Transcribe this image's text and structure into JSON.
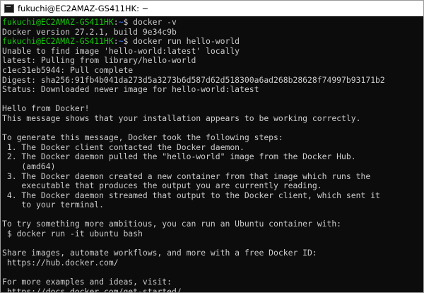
{
  "window": {
    "title": "fukuchi@EC2AMAZ-GS411HK: ~",
    "icon": "terminal-icon"
  },
  "colors": {
    "background": "#0c0c0c",
    "text": "#cccccc",
    "prompt_user": "#16c60c",
    "prompt_path": "#3b78ff"
  },
  "terminal": {
    "lines": [
      {
        "type": "prompt",
        "user": "fukuchi@EC2AMAZ-GS411HK",
        "sep": ":",
        "path": "~",
        "symbol": "$ ",
        "command": "docker -v"
      },
      {
        "type": "text",
        "text": "Docker version 27.2.1, build 9e34c9b"
      },
      {
        "type": "prompt",
        "user": "fukuchi@EC2AMAZ-GS411HK",
        "sep": ":",
        "path": "~",
        "symbol": "$ ",
        "command": "docker run hello-world"
      },
      {
        "type": "text",
        "text": "Unable to find image 'hello-world:latest' locally"
      },
      {
        "type": "text",
        "text": "latest: Pulling from library/hello-world"
      },
      {
        "type": "text",
        "text": "c1ec31eb5944: Pull complete"
      },
      {
        "type": "text",
        "text": "Digest: sha256:91fb4b041da273d5a3273b6d587d62d518300a6ad268b28628f74997b93171b2"
      },
      {
        "type": "text",
        "text": "Status: Downloaded newer image for hello-world:latest"
      },
      {
        "type": "text",
        "text": ""
      },
      {
        "type": "text",
        "text": "Hello from Docker!"
      },
      {
        "type": "text",
        "text": "This message shows that your installation appears to be working correctly."
      },
      {
        "type": "text",
        "text": ""
      },
      {
        "type": "text",
        "text": "To generate this message, Docker took the following steps:"
      },
      {
        "type": "text",
        "text": " 1. The Docker client contacted the Docker daemon."
      },
      {
        "type": "text",
        "text": " 2. The Docker daemon pulled the \"hello-world\" image from the Docker Hub."
      },
      {
        "type": "text",
        "text": "    (amd64)"
      },
      {
        "type": "text",
        "text": " 3. The Docker daemon created a new container from that image which runs the"
      },
      {
        "type": "text",
        "text": "    executable that produces the output you are currently reading."
      },
      {
        "type": "text",
        "text": " 4. The Docker daemon streamed that output to the Docker client, which sent it"
      },
      {
        "type": "text",
        "text": "    to your terminal."
      },
      {
        "type": "text",
        "text": ""
      },
      {
        "type": "text",
        "text": "To try something more ambitious, you can run an Ubuntu container with:"
      },
      {
        "type": "text",
        "text": " $ docker run -it ubuntu bash"
      },
      {
        "type": "text",
        "text": ""
      },
      {
        "type": "text",
        "text": "Share images, automate workflows, and more with a free Docker ID:"
      },
      {
        "type": "text",
        "text": " https://hub.docker.com/"
      },
      {
        "type": "text",
        "text": ""
      },
      {
        "type": "text",
        "text": "For more examples and ideas, visit:"
      },
      {
        "type": "text",
        "text": " https://docs.docker.com/get-started/"
      }
    ]
  }
}
